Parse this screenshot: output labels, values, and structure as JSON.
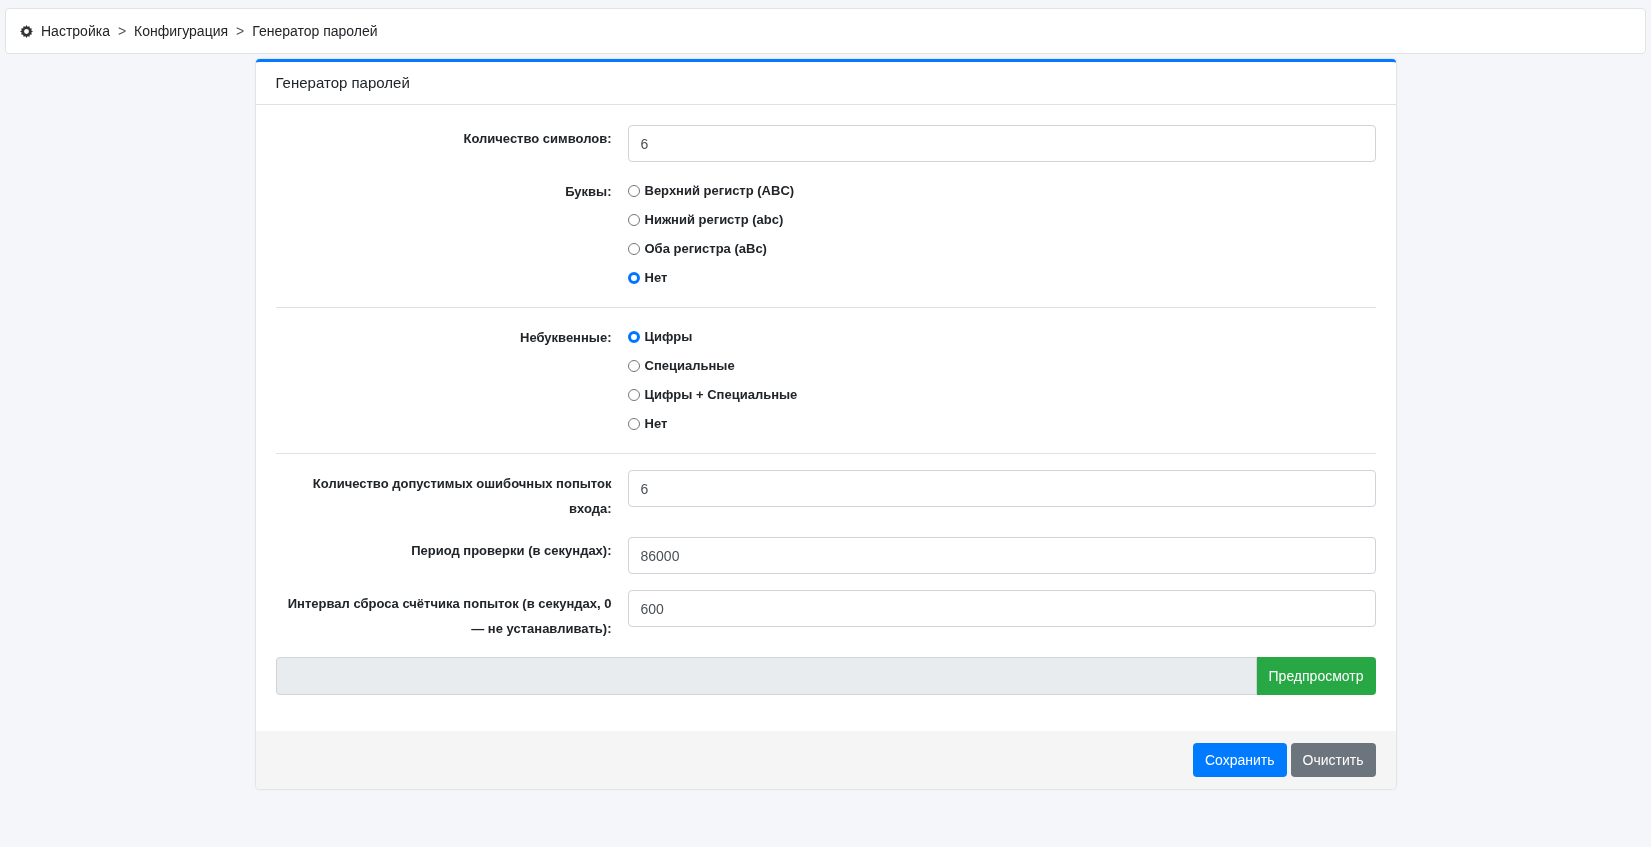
{
  "breadcrumb": [
    {
      "kind": "link",
      "text": "Настройка"
    },
    {
      "kind": "separator",
      "text": ">"
    },
    {
      "kind": "link",
      "text": "Конфигурация"
    },
    {
      "kind": "separator",
      "text": ">"
    },
    {
      "kind": "current",
      "text": "Генератор паролей"
    }
  ],
  "card": {
    "title": "Генератор паролей",
    "sections": [
      [
        {
          "kind": "input",
          "label": "Количество символов:",
          "value": "6"
        },
        {
          "kind": "radio",
          "label": "Буквы:",
          "options": [
            {
              "label": "Верхний регистр (ABC)",
              "selected": false
            },
            {
              "label": "Нижний регистр (abc)",
              "selected": false
            },
            {
              "label": "Оба регистра (aBc)",
              "selected": false
            },
            {
              "label": "Нет",
              "selected": true
            }
          ]
        }
      ],
      [
        {
          "kind": "radio",
          "label": "Небуквенные:",
          "options": [
            {
              "label": "Цифры",
              "selected": true
            },
            {
              "label": "Специальные",
              "selected": false
            },
            {
              "label": "Цифры + Специальные",
              "selected": false
            },
            {
              "label": "Нет",
              "selected": false
            }
          ]
        }
      ],
      [
        {
          "kind": "input",
          "label": "Количество допустимых ошибочных попыток входа:",
          "value": "6"
        },
        {
          "kind": "input",
          "label": "Период проверки (в секундах):",
          "value": "86000"
        },
        {
          "kind": "input",
          "label": "Интервал сброса счётчика попыток (в секундах, 0 — не устанавливать):",
          "value": "600"
        }
      ]
    ],
    "preview_button": "Предпросмотр",
    "footer_buttons": [
      {
        "kind": "primary",
        "label": "Сохранить"
      },
      {
        "kind": "secondary",
        "label": "Очистить"
      }
    ]
  }
}
